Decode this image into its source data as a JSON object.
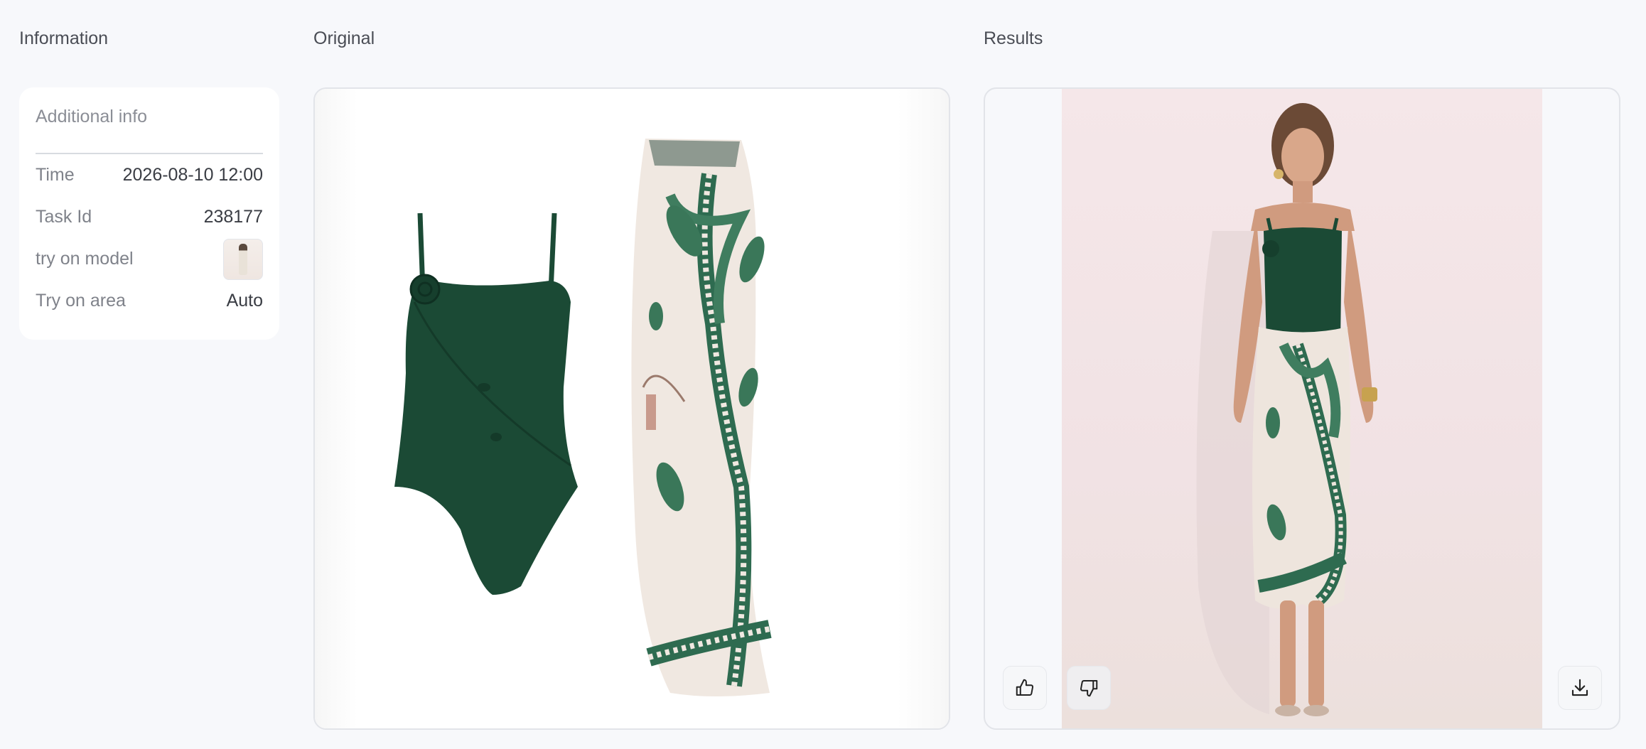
{
  "columns": {
    "information": "Information",
    "original": "Original",
    "results": "Results"
  },
  "info_card": {
    "title": "Additional info",
    "rows": [
      {
        "label": "Time",
        "value": "2026-08-10 12:00"
      },
      {
        "label": "Task Id",
        "value": "238177"
      },
      {
        "label": "try on model",
        "value": ""
      },
      {
        "label": "Try on area",
        "value": "Auto"
      }
    ]
  },
  "images": {
    "original": "green-swimsuit-and-sarong-product-image",
    "result": "model-wearing-swimsuit-and-sarong"
  },
  "actions": {
    "like_icon": "thumbs-up-icon",
    "dislike_icon": "thumbs-down-icon",
    "download_icon": "download-icon"
  },
  "colors": {
    "page_bg": "#f7f8fb",
    "swimsuit_green": "#1b4a35"
  }
}
